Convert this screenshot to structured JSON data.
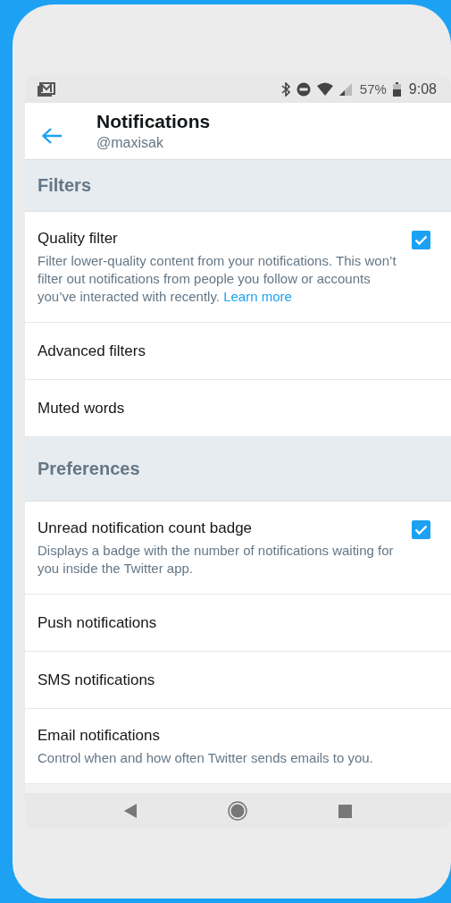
{
  "status_bar": {
    "battery": "57%",
    "time": "9:08"
  },
  "header": {
    "title": "Notifications",
    "subtitle": "@maxisak"
  },
  "sections": [
    {
      "title": "Filters",
      "items": [
        {
          "kind": "checkbox",
          "label": "Quality filter",
          "description": "Filter lower-quality content from your notifications. This won’t filter out notifications from people you follow or accounts you’ve interacted with recently.",
          "link": "Learn more",
          "checked": true
        },
        {
          "kind": "nav",
          "label": "Advanced filters"
        },
        {
          "kind": "nav",
          "label": "Muted words"
        }
      ]
    },
    {
      "title": "Preferences",
      "items": [
        {
          "kind": "checkbox",
          "label": "Unread notification count badge",
          "description": "Displays a badge with the number of notifications waiting for you inside the Twitter app.",
          "checked": true
        },
        {
          "kind": "nav",
          "label": "Push notifications"
        },
        {
          "kind": "nav",
          "label": "SMS notifications"
        },
        {
          "kind": "nav",
          "label": "Email notifications",
          "description": "Control when and how often Twitter sends emails to you."
        }
      ]
    }
  ]
}
